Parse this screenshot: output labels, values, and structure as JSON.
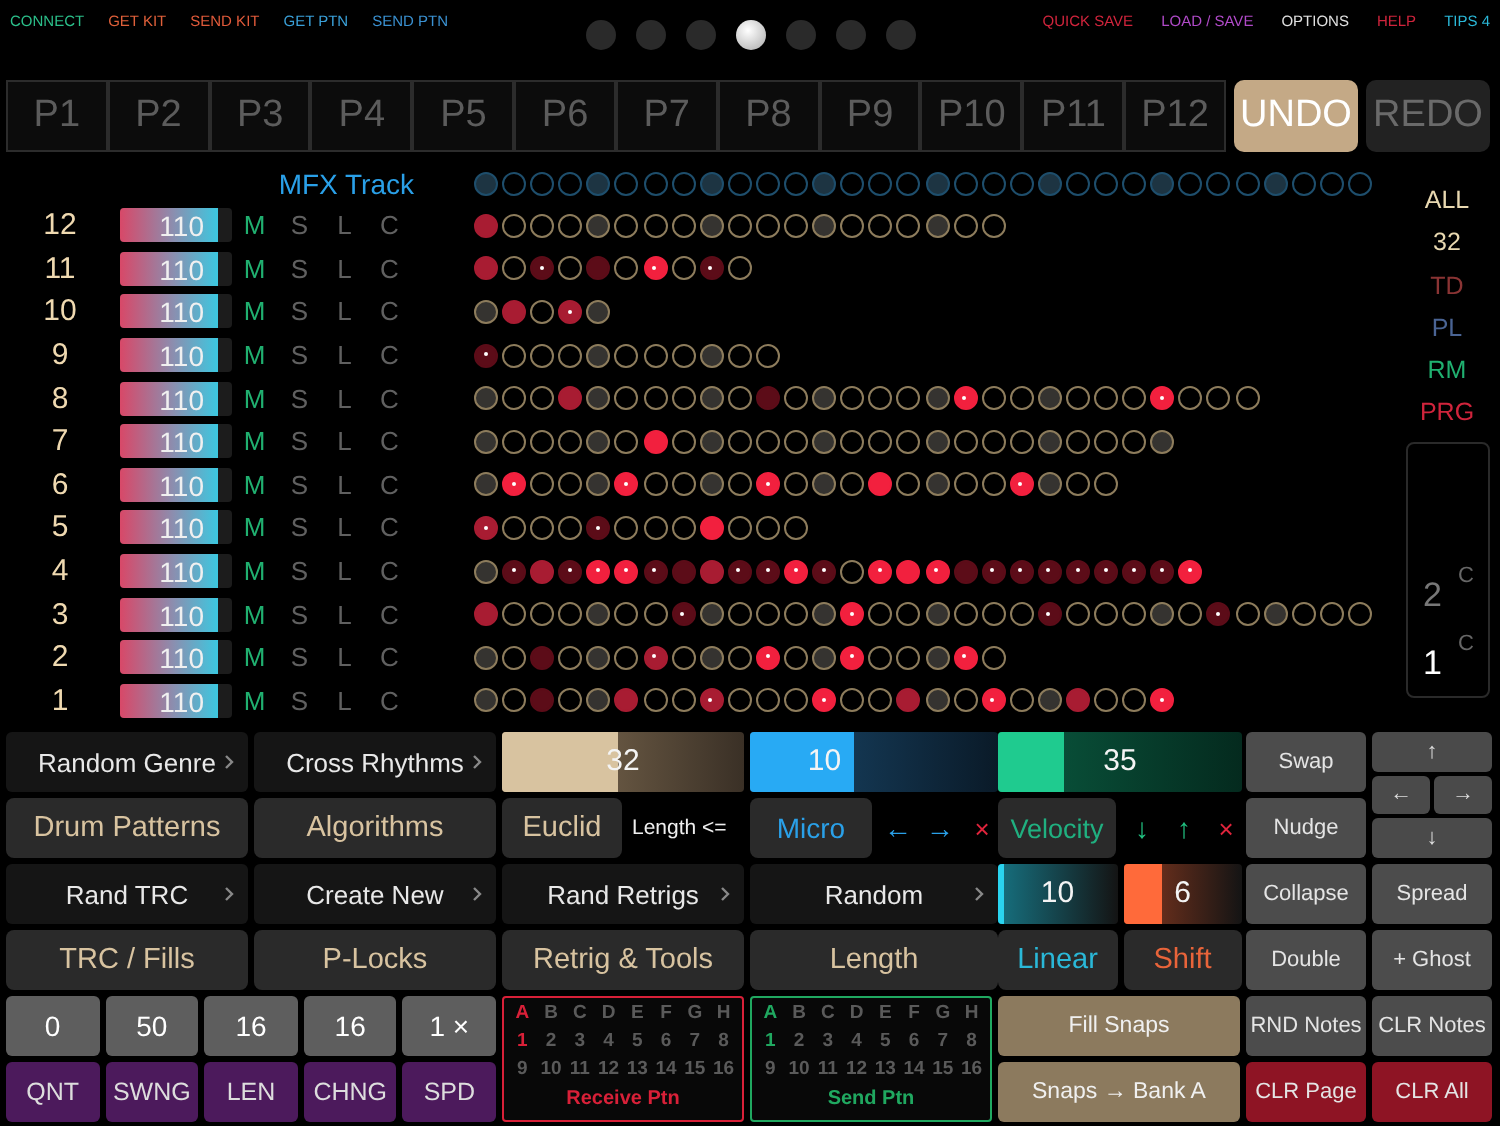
{
  "top_left": [
    {
      "label": "CONNECT",
      "color": "#2bbf8a"
    },
    {
      "label": "GET KIT",
      "color": "#e0603a"
    },
    {
      "label": "SEND KIT",
      "color": "#e05a3a"
    },
    {
      "label": "GET PTN",
      "color": "#3aa0d8"
    },
    {
      "label": "SEND PTN",
      "color": "#3a90d0"
    }
  ],
  "page_dots": [
    {
      "selected": false
    },
    {
      "selected": false
    },
    {
      "selected": false
    },
    {
      "selected": true
    },
    {
      "selected": false
    },
    {
      "selected": false
    },
    {
      "selected": false
    }
  ],
  "top_right": [
    {
      "label": "QUICK SAVE",
      "color": "#d0243c"
    },
    {
      "label": "LOAD / SAVE",
      "color": "#b04ac8"
    },
    {
      "label": "OPTIONS",
      "color": "#e0e0e0"
    },
    {
      "label": "HELP",
      "color": "#d0243c"
    },
    {
      "label": "TIPS 4",
      "color": "#2ab8d8"
    }
  ],
  "patterns": [
    "P1",
    "P2",
    "P3",
    "P4",
    "P5",
    "P6",
    "P7",
    "P8",
    "P9",
    "P10",
    "P11",
    "P12"
  ],
  "undo": {
    "label": "UNDO",
    "disabled": false
  },
  "redo": {
    "label": "REDO",
    "disabled": true
  },
  "mfx": {
    "label": "MFX Track",
    "steps": [
      {
        "kind": "beat"
      },
      {
        "kind": "off"
      },
      {
        "kind": "off"
      },
      {
        "kind": "off"
      },
      {
        "kind": "beat"
      },
      {
        "kind": "off"
      },
      {
        "kind": "off"
      },
      {
        "kind": "off"
      },
      {
        "kind": "beat"
      },
      {
        "kind": "off"
      },
      {
        "kind": "off"
      },
      {
        "kind": "off"
      },
      {
        "kind": "beat"
      },
      {
        "kind": "off"
      },
      {
        "kind": "off"
      },
      {
        "kind": "off"
      },
      {
        "kind": "beat"
      },
      {
        "kind": "off"
      },
      {
        "kind": "off"
      },
      {
        "kind": "off"
      },
      {
        "kind": "beat"
      },
      {
        "kind": "off"
      },
      {
        "kind": "off"
      },
      {
        "kind": "off"
      },
      {
        "kind": "beat"
      },
      {
        "kind": "off"
      },
      {
        "kind": "off"
      },
      {
        "kind": "off"
      },
      {
        "kind": "beat"
      },
      {
        "kind": "off"
      },
      {
        "kind": "off"
      },
      {
        "kind": "off"
      }
    ]
  },
  "tracks": [
    {
      "number": "12",
      "velocity": "110",
      "level": 0.87,
      "flags": [
        {
          "label": "M",
          "on": true
        },
        {
          "label": "S",
          "on": false
        },
        {
          "label": "L",
          "on": false
        },
        {
          "label": "C",
          "on": false
        }
      ],
      "steps": [
        {
          "kind": "mid"
        },
        {
          "kind": "off"
        },
        {
          "kind": "off"
        },
        {
          "kind": "off"
        },
        {
          "kind": "beat"
        },
        {
          "kind": "off"
        },
        {
          "kind": "off"
        },
        {
          "kind": "off"
        },
        {
          "kind": "beat"
        },
        {
          "kind": "off"
        },
        {
          "kind": "off"
        },
        {
          "kind": "off"
        },
        {
          "kind": "beat"
        },
        {
          "kind": "off"
        },
        {
          "kind": "off"
        },
        {
          "kind": "off"
        },
        {
          "kind": "beat"
        },
        {
          "kind": "off"
        },
        {
          "kind": "off"
        }
      ]
    },
    {
      "number": "11",
      "velocity": "110",
      "level": 0.87,
      "flags": [
        {
          "label": "M",
          "on": true
        },
        {
          "label": "S",
          "on": false
        },
        {
          "label": "L",
          "on": false
        },
        {
          "label": "C",
          "on": false
        }
      ],
      "steps": [
        {
          "kind": "mid"
        },
        {
          "kind": "off"
        },
        {
          "kind": "lo-dot"
        },
        {
          "kind": "off"
        },
        {
          "kind": "lo"
        },
        {
          "kind": "off"
        },
        {
          "kind": "hi-dot"
        },
        {
          "kind": "off"
        },
        {
          "kind": "lo-dot"
        },
        {
          "kind": "off"
        }
      ]
    },
    {
      "number": "10",
      "velocity": "110",
      "level": 0.87,
      "flags": [
        {
          "label": "M",
          "on": true
        },
        {
          "label": "S",
          "on": false
        },
        {
          "label": "L",
          "on": false
        },
        {
          "label": "C",
          "on": false
        }
      ],
      "steps": [
        {
          "kind": "beat"
        },
        {
          "kind": "mid"
        },
        {
          "kind": "off"
        },
        {
          "kind": "mid-dot"
        },
        {
          "kind": "beat"
        }
      ]
    },
    {
      "number": "9",
      "velocity": "110",
      "level": 0.87,
      "flags": [
        {
          "label": "M",
          "on": true
        },
        {
          "label": "S",
          "on": false
        },
        {
          "label": "L",
          "on": false
        },
        {
          "label": "C",
          "on": false
        }
      ],
      "steps": [
        {
          "kind": "lo-dot"
        },
        {
          "kind": "off"
        },
        {
          "kind": "off"
        },
        {
          "kind": "off"
        },
        {
          "kind": "beat"
        },
        {
          "kind": "off"
        },
        {
          "kind": "off"
        },
        {
          "kind": "off"
        },
        {
          "kind": "beat"
        },
        {
          "kind": "off"
        },
        {
          "kind": "off"
        }
      ]
    },
    {
      "number": "8",
      "velocity": "110",
      "level": 0.87,
      "flags": [
        {
          "label": "M",
          "on": true
        },
        {
          "label": "S",
          "on": false
        },
        {
          "label": "L",
          "on": false
        },
        {
          "label": "C",
          "on": false
        }
      ],
      "steps": [
        {
          "kind": "beat"
        },
        {
          "kind": "off"
        },
        {
          "kind": "off"
        },
        {
          "kind": "mid"
        },
        {
          "kind": "beat"
        },
        {
          "kind": "off"
        },
        {
          "kind": "off"
        },
        {
          "kind": "off"
        },
        {
          "kind": "beat"
        },
        {
          "kind": "off"
        },
        {
          "kind": "lo"
        },
        {
          "kind": "off"
        },
        {
          "kind": "beat"
        },
        {
          "kind": "off"
        },
        {
          "kind": "off"
        },
        {
          "kind": "off"
        },
        {
          "kind": "beat"
        },
        {
          "kind": "hi-dot"
        },
        {
          "kind": "off"
        },
        {
          "kind": "off"
        },
        {
          "kind": "beat"
        },
        {
          "kind": "off"
        },
        {
          "kind": "off"
        },
        {
          "kind": "off"
        },
        {
          "kind": "hi-dot"
        },
        {
          "kind": "off"
        },
        {
          "kind": "off"
        },
        {
          "kind": "off"
        }
      ]
    },
    {
      "number": "7",
      "velocity": "110",
      "level": 0.87,
      "flags": [
        {
          "label": "M",
          "on": true
        },
        {
          "label": "S",
          "on": false
        },
        {
          "label": "L",
          "on": false
        },
        {
          "label": "C",
          "on": false
        }
      ],
      "steps": [
        {
          "kind": "beat"
        },
        {
          "kind": "off"
        },
        {
          "kind": "off"
        },
        {
          "kind": "off"
        },
        {
          "kind": "beat"
        },
        {
          "kind": "off"
        },
        {
          "kind": "hi"
        },
        {
          "kind": "off"
        },
        {
          "kind": "beat"
        },
        {
          "kind": "off"
        },
        {
          "kind": "off"
        },
        {
          "kind": "off"
        },
        {
          "kind": "beat"
        },
        {
          "kind": "off"
        },
        {
          "kind": "off"
        },
        {
          "kind": "off"
        },
        {
          "kind": "beat"
        },
        {
          "kind": "off"
        },
        {
          "kind": "off"
        },
        {
          "kind": "off"
        },
        {
          "kind": "beat"
        },
        {
          "kind": "off"
        },
        {
          "kind": "off"
        },
        {
          "kind": "off"
        },
        {
          "kind": "beat"
        }
      ]
    },
    {
      "number": "6",
      "velocity": "110",
      "level": 0.87,
      "flags": [
        {
          "label": "M",
          "on": true
        },
        {
          "label": "S",
          "on": false
        },
        {
          "label": "L",
          "on": false
        },
        {
          "label": "C",
          "on": false
        }
      ],
      "steps": [
        {
          "kind": "beat"
        },
        {
          "kind": "hi-dot"
        },
        {
          "kind": "off"
        },
        {
          "kind": "off"
        },
        {
          "kind": "beat"
        },
        {
          "kind": "hi-dot"
        },
        {
          "kind": "off"
        },
        {
          "kind": "off"
        },
        {
          "kind": "beat"
        },
        {
          "kind": "off"
        },
        {
          "kind": "hi-dot"
        },
        {
          "kind": "off"
        },
        {
          "kind": "beat"
        },
        {
          "kind": "off"
        },
        {
          "kind": "hi"
        },
        {
          "kind": "off"
        },
        {
          "kind": "beat"
        },
        {
          "kind": "off"
        },
        {
          "kind": "off"
        },
        {
          "kind": "hi-dot"
        },
        {
          "kind": "beat"
        },
        {
          "kind": "off"
        },
        {
          "kind": "off"
        }
      ]
    },
    {
      "number": "5",
      "velocity": "110",
      "level": 0.87,
      "flags": [
        {
          "label": "M",
          "on": true
        },
        {
          "label": "S",
          "on": false
        },
        {
          "label": "L",
          "on": false
        },
        {
          "label": "C",
          "on": false
        }
      ],
      "steps": [
        {
          "kind": "mid-dot"
        },
        {
          "kind": "off"
        },
        {
          "kind": "off"
        },
        {
          "kind": "off"
        },
        {
          "kind": "lo-dot"
        },
        {
          "kind": "off"
        },
        {
          "kind": "off"
        },
        {
          "kind": "off"
        },
        {
          "kind": "hi"
        },
        {
          "kind": "off"
        },
        {
          "kind": "off"
        },
        {
          "kind": "off"
        }
      ]
    },
    {
      "number": "4",
      "velocity": "110",
      "level": 0.87,
      "flags": [
        {
          "label": "M",
          "on": true
        },
        {
          "label": "S",
          "on": false
        },
        {
          "label": "L",
          "on": false
        },
        {
          "label": "C",
          "on": false
        }
      ],
      "steps": [
        {
          "kind": "beat"
        },
        {
          "kind": "lo-dot"
        },
        {
          "kind": "mid"
        },
        {
          "kind": "lo-dot"
        },
        {
          "kind": "hi-dot"
        },
        {
          "kind": "hi-dot"
        },
        {
          "kind": "lo-dot"
        },
        {
          "kind": "lo"
        },
        {
          "kind": "mid"
        },
        {
          "kind": "lo-dot"
        },
        {
          "kind": "lo-dot"
        },
        {
          "kind": "hi-dot"
        },
        {
          "kind": "lo-dot"
        },
        {
          "kind": "off"
        },
        {
          "kind": "hi-dot"
        },
        {
          "kind": "hi"
        },
        {
          "kind": "hi-dot"
        },
        {
          "kind": "lo"
        },
        {
          "kind": "lo-dot"
        },
        {
          "kind": "lo-dot"
        },
        {
          "kind": "lo-dot"
        },
        {
          "kind": "lo-dot"
        },
        {
          "kind": "lo-dot"
        },
        {
          "kind": "lo-dot"
        },
        {
          "kind": "lo-dot"
        },
        {
          "kind": "hi-dot"
        }
      ]
    },
    {
      "number": "3",
      "velocity": "110",
      "level": 0.87,
      "flags": [
        {
          "label": "M",
          "on": true
        },
        {
          "label": "S",
          "on": false
        },
        {
          "label": "L",
          "on": false
        },
        {
          "label": "C",
          "on": false
        }
      ],
      "steps": [
        {
          "kind": "mid"
        },
        {
          "kind": "off"
        },
        {
          "kind": "off"
        },
        {
          "kind": "off"
        },
        {
          "kind": "beat"
        },
        {
          "kind": "off"
        },
        {
          "kind": "off"
        },
        {
          "kind": "lo-dot"
        },
        {
          "kind": "beat"
        },
        {
          "kind": "off"
        },
        {
          "kind": "off"
        },
        {
          "kind": "off"
        },
        {
          "kind": "beat"
        },
        {
          "kind": "hi-dot"
        },
        {
          "kind": "off"
        },
        {
          "kind": "off"
        },
        {
          "kind": "beat"
        },
        {
          "kind": "off"
        },
        {
          "kind": "off"
        },
        {
          "kind": "off"
        },
        {
          "kind": "lo-dot"
        },
        {
          "kind": "off"
        },
        {
          "kind": "off"
        },
        {
          "kind": "off"
        },
        {
          "kind": "beat"
        },
        {
          "kind": "off"
        },
        {
          "kind": "lo-dot"
        },
        {
          "kind": "off"
        },
        {
          "kind": "beat"
        },
        {
          "kind": "off"
        },
        {
          "kind": "off"
        },
        {
          "kind": "off"
        }
      ]
    },
    {
      "number": "2",
      "velocity": "110",
      "level": 0.87,
      "flags": [
        {
          "label": "M",
          "on": true
        },
        {
          "label": "S",
          "on": false
        },
        {
          "label": "L",
          "on": false
        },
        {
          "label": "C",
          "on": false
        }
      ],
      "steps": [
        {
          "kind": "beat"
        },
        {
          "kind": "off"
        },
        {
          "kind": "lo"
        },
        {
          "kind": "off"
        },
        {
          "kind": "beat"
        },
        {
          "kind": "off"
        },
        {
          "kind": "mid-dot"
        },
        {
          "kind": "off"
        },
        {
          "kind": "beat"
        },
        {
          "kind": "off"
        },
        {
          "kind": "hi-dot"
        },
        {
          "kind": "off"
        },
        {
          "kind": "beat"
        },
        {
          "kind": "hi-dot"
        },
        {
          "kind": "off"
        },
        {
          "kind": "off"
        },
        {
          "kind": "beat"
        },
        {
          "kind": "hi-dot"
        },
        {
          "kind": "off"
        }
      ]
    },
    {
      "number": "1",
      "velocity": "110",
      "level": 0.87,
      "flags": [
        {
          "label": "M",
          "on": true
        },
        {
          "label": "S",
          "on": false
        },
        {
          "label": "L",
          "on": false
        },
        {
          "label": "C",
          "on": false
        }
      ],
      "steps": [
        {
          "kind": "beat"
        },
        {
          "kind": "off"
        },
        {
          "kind": "lo"
        },
        {
          "kind": "off"
        },
        {
          "kind": "beat"
        },
        {
          "kind": "mid"
        },
        {
          "kind": "off"
        },
        {
          "kind": "off"
        },
        {
          "kind": "mid-dot"
        },
        {
          "kind": "off"
        },
        {
          "kind": "off"
        },
        {
          "kind": "off"
        },
        {
          "kind": "hi-dot"
        },
        {
          "kind": "off"
        },
        {
          "kind": "off"
        },
        {
          "kind": "mid"
        },
        {
          "kind": "beat"
        },
        {
          "kind": "off"
        },
        {
          "kind": "hi-dot"
        },
        {
          "kind": "off"
        },
        {
          "kind": "beat"
        },
        {
          "kind": "mid"
        },
        {
          "kind": "off"
        },
        {
          "kind": "off"
        },
        {
          "kind": "hi-dot"
        }
      ]
    }
  ],
  "filters": [
    {
      "label": "ALL",
      "color": "#e8d8b0"
    },
    {
      "label": "32",
      "color": "#e8d8b0"
    },
    {
      "label": "TD",
      "color": "#8a3434"
    },
    {
      "label": "PL",
      "color": "#4a6494"
    },
    {
      "label": "RM",
      "color": "#20b070"
    },
    {
      "label": "PRG",
      "color": "#d0243c"
    }
  ],
  "slots": [
    {
      "number": "2",
      "tag": "C",
      "selected": false
    },
    {
      "number": "1",
      "tag": "C",
      "selected": true
    }
  ],
  "generators": [
    {
      "label": "Random Genre",
      "kind": "menu"
    },
    {
      "label": "Cross Rhythms",
      "kind": "menu"
    },
    {
      "label": "Drum Patterns",
      "kind": "main"
    },
    {
      "label": "Algorithms",
      "kind": "main"
    },
    {
      "label": "Rand TRC",
      "kind": "menu"
    },
    {
      "label": "Create New",
      "kind": "menu"
    },
    {
      "label": "TRC / Fills",
      "kind": "main"
    },
    {
      "label": "P-Locks",
      "kind": "main"
    }
  ],
  "euclid": {
    "slider": {
      "reading": "32",
      "level": 0.48
    },
    "button": "Euclid",
    "note": "Length <=",
    "menu": "Rand Retrigs",
    "tools": "Retrig & Tools"
  },
  "micro": {
    "slider": {
      "reading": "10",
      "level": 0.42
    },
    "button": "Micro",
    "actions": [
      {
        "label": "←",
        "kind": "move"
      },
      {
        "label": "→",
        "kind": "move"
      },
      {
        "label": "×",
        "kind": "clear"
      }
    ],
    "menu": "Random",
    "tools": "Length"
  },
  "velocity": {
    "slider": {
      "reading": "35",
      "level": 0.27
    },
    "button": "Velocity",
    "actions": [
      {
        "label": "↓",
        "kind": "move"
      },
      {
        "label": "↑",
        "kind": "move"
      },
      {
        "label": "×",
        "kind": "clear"
      }
    ],
    "mini_sliders": [
      {
        "reading": "10",
        "level": 0.05,
        "color": "#2ad4f0"
      },
      {
        "reading": "6",
        "level": 0.33,
        "color": "#ff6a3a"
      }
    ],
    "modes": [
      "Linear",
      "Shift"
    ]
  },
  "edit": {
    "swap": "Swap",
    "nudge": "Nudge",
    "nav": [
      "↑",
      "←",
      "→",
      "↓"
    ],
    "buttons": [
      {
        "label": "Collapse",
        "kind": "grey"
      },
      {
        "label": "Spread",
        "kind": "grey"
      },
      {
        "label": "Double",
        "kind": "grey"
      },
      {
        "label": "+ Ghost",
        "kind": "grey"
      },
      {
        "label": "RND Notes",
        "kind": "grey"
      },
      {
        "label": "CLR Notes",
        "kind": "grey"
      },
      {
        "label": "CLR Page",
        "kind": "red"
      },
      {
        "label": "CLR All",
        "kind": "red"
      }
    ]
  },
  "params": [
    {
      "value": "0",
      "label": "QNT"
    },
    {
      "value": "50",
      "label": "SWNG"
    },
    {
      "value": "16",
      "label": "LEN"
    },
    {
      "value": "16",
      "label": "CHNG"
    },
    {
      "value": "1 ×",
      "label": "SPD"
    }
  ],
  "transfer": [
    {
      "title": "Receive Ptn",
      "color": "#d82038",
      "banks": [
        {
          "label": "A",
          "selected": true
        },
        {
          "label": "B",
          "selected": false
        },
        {
          "label": "C",
          "selected": false
        },
        {
          "label": "D",
          "selected": false
        },
        {
          "label": "E",
          "selected": false
        },
        {
          "label": "F",
          "selected": false
        },
        {
          "label": "G",
          "selected": false
        },
        {
          "label": "H",
          "selected": false
        }
      ],
      "patterns": [
        {
          "label": "1",
          "selected": true
        },
        {
          "label": "2",
          "selected": false
        },
        {
          "label": "3",
          "selected": false
        },
        {
          "label": "4",
          "selected": false
        },
        {
          "label": "5",
          "selected": false
        },
        {
          "label": "6",
          "selected": false
        },
        {
          "label": "7",
          "selected": false
        },
        {
          "label": "8",
          "selected": false
        },
        {
          "label": "9",
          "selected": false
        },
        {
          "label": "10",
          "selected": false
        },
        {
          "label": "11",
          "selected": false
        },
        {
          "label": "12",
          "selected": false
        },
        {
          "label": "13",
          "selected": false
        },
        {
          "label": "14",
          "selected": false
        },
        {
          "label": "15",
          "selected": false
        },
        {
          "label": "16",
          "selected": false
        }
      ]
    },
    {
      "title": "Send Ptn",
      "color": "#20a860",
      "banks": [
        {
          "label": "A",
          "selected": true
        },
        {
          "label": "B",
          "selected": false
        },
        {
          "label": "C",
          "selected": false
        },
        {
          "label": "D",
          "selected": false
        },
        {
          "label": "E",
          "selected": false
        },
        {
          "label": "F",
          "selected": false
        },
        {
          "label": "G",
          "selected": false
        },
        {
          "label": "H",
          "selected": false
        }
      ],
      "patterns": [
        {
          "label": "1",
          "selected": true
        },
        {
          "label": "2",
          "selected": false
        },
        {
          "label": "3",
          "selected": false
        },
        {
          "label": "4",
          "selected": false
        },
        {
          "label": "5",
          "selected": false
        },
        {
          "label": "6",
          "selected": false
        },
        {
          "label": "7",
          "selected": false
        },
        {
          "label": "8",
          "selected": false
        },
        {
          "label": "9",
          "selected": false
        },
        {
          "label": "10",
          "selected": false
        },
        {
          "label": "11",
          "selected": false
        },
        {
          "label": "12",
          "selected": false
        },
        {
          "label": "13",
          "selected": false
        },
        {
          "label": "14",
          "selected": false
        },
        {
          "label": "15",
          "selected": false
        },
        {
          "label": "16",
          "selected": false
        }
      ]
    }
  ],
  "snaps": [
    "Fill Snaps",
    "Snaps → Bank A"
  ]
}
